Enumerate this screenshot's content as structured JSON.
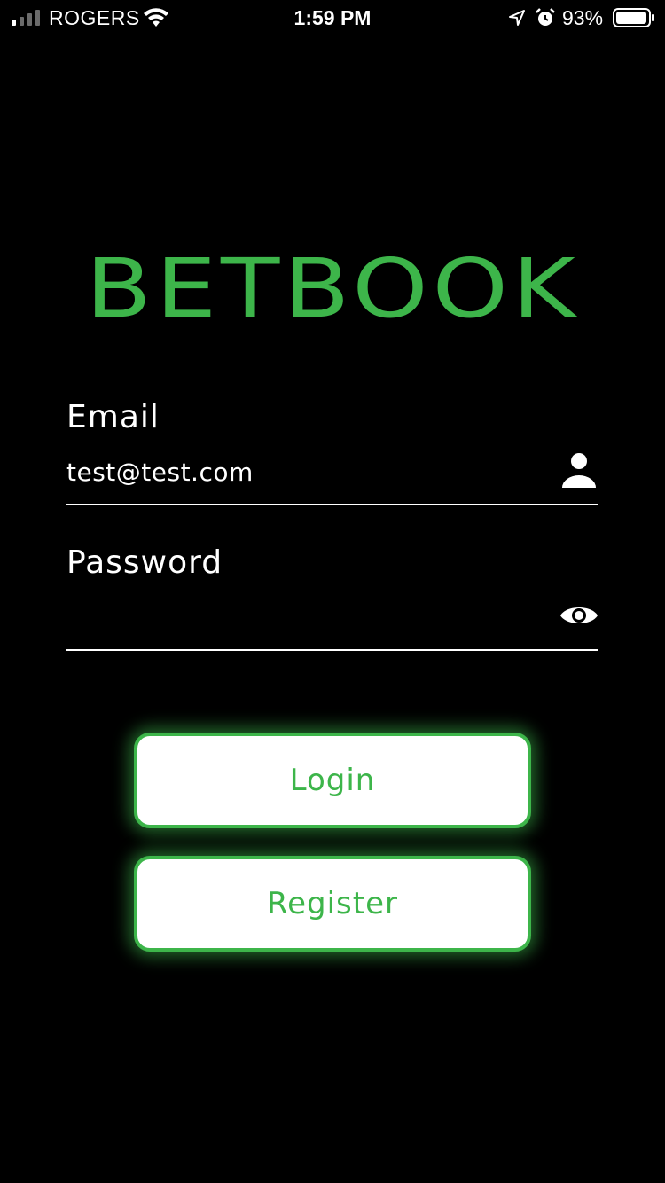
{
  "status_bar": {
    "carrier": "ROGERS",
    "time": "1:59 PM",
    "battery_percent": "93%",
    "icons": [
      "signal-icon",
      "wifi-icon",
      "location-icon",
      "alarm-icon",
      "battery-icon"
    ]
  },
  "logo": {
    "text": "BETBOOK",
    "color": "#3db54a"
  },
  "form": {
    "email": {
      "label": "Email",
      "value": "test@test.com",
      "icon": "user-icon"
    },
    "password": {
      "label": "Password",
      "value": "",
      "icon": "eye-icon"
    }
  },
  "buttons": {
    "login": "Login",
    "register": "Register"
  },
  "colors": {
    "accent": "#3db54a",
    "background": "#000000",
    "text": "#ffffff"
  }
}
